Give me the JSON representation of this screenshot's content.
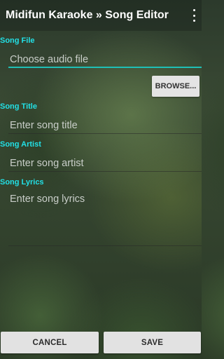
{
  "action_bar": {
    "title": "Midifun Karaoke » Song Editor",
    "overflow_icon": "more-vert-icon"
  },
  "song_file": {
    "label": "Song File",
    "placeholder": "Choose audio file",
    "value": "",
    "browse_label": "BROWSE..."
  },
  "song_title": {
    "label": "Song Title",
    "placeholder": "Enter song title",
    "value": ""
  },
  "song_artist": {
    "label": "Song Artist",
    "placeholder": "Enter song artist",
    "value": ""
  },
  "song_lyrics": {
    "label": "Song Lyrics",
    "placeholder": "Enter song lyrics",
    "value": ""
  },
  "buttons": {
    "cancel_label": "CANCEL",
    "save_label": "SAVE"
  },
  "colors": {
    "label_accent": "#22e0e6",
    "focus_underline": "#1fbfb6",
    "button_bg": "#e2e2e2"
  }
}
